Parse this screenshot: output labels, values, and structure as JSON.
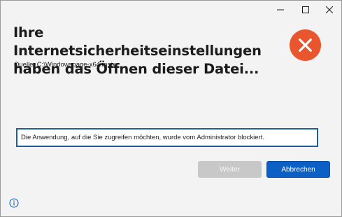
{
  "dialog": {
    "title": "Ihre Internetsicherheitseinstellungen haben das Öffnen dieser Datei...",
    "source": "Quelle: C:\\Windowspage-x64.msix",
    "message": "Die Anwendung, auf die Sie zugreifen möchten, wurde vom Administrator blockiert."
  },
  "buttons": {
    "continue_label": "Weiter",
    "cancel_label": "Abbrechen"
  },
  "icons": {
    "status": "error-icon",
    "info": "info-icon",
    "window_controls": [
      "minimize-icon",
      "maximize-icon",
      "close-icon"
    ]
  },
  "colors": {
    "error": "#e9552c",
    "accent": "#0c5fc4",
    "disabled_button": "#c8c8c8",
    "focus_border": "#1f5f9e",
    "info": "#0a63c9"
  }
}
